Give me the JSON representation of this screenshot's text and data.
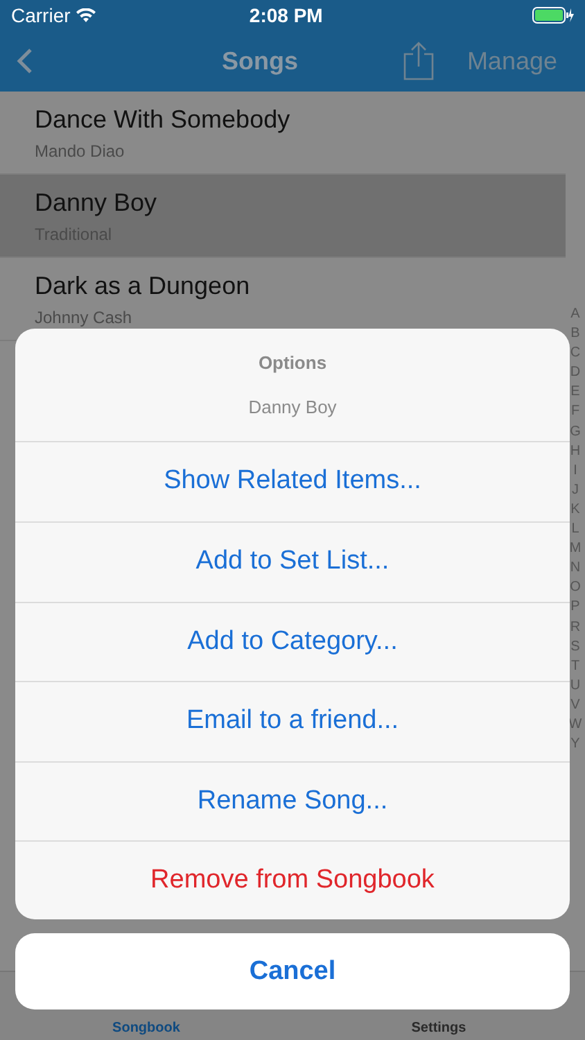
{
  "status_bar": {
    "carrier": "Carrier",
    "time": "2:08 PM"
  },
  "nav": {
    "title": "Songs",
    "action": "Manage"
  },
  "songs": [
    {
      "title": "Dance With Somebody",
      "artist": "Mando Diao",
      "selected": false
    },
    {
      "title": "Danny Boy",
      "artist": "Traditional",
      "selected": true
    },
    {
      "title": "Dark as a Dungeon",
      "artist": "Johnny Cash",
      "selected": false
    }
  ],
  "index": [
    "A",
    "B",
    "C",
    "D",
    "E",
    "F",
    "G",
    "H",
    "I",
    "J",
    "K",
    "L",
    "M",
    "N",
    "O",
    "P",
    "R",
    "S",
    "T",
    "U",
    "V",
    "W",
    "Y"
  ],
  "tabs": [
    {
      "label": "Songbook",
      "selected": true
    },
    {
      "label": "Settings",
      "selected": false
    }
  ],
  "sheet": {
    "title": "Options",
    "subtitle": "Danny Boy",
    "actions": [
      {
        "label": "Show Related Items...",
        "kind": "default"
      },
      {
        "label": "Add to Set List...",
        "kind": "default"
      },
      {
        "label": "Add to Category...",
        "kind": "default"
      },
      {
        "label": "Email to a friend...",
        "kind": "default"
      },
      {
        "label": "Rename Song...",
        "kind": "default"
      },
      {
        "label": "Remove from Songbook",
        "kind": "destructive"
      }
    ],
    "cancel": "Cancel"
  }
}
